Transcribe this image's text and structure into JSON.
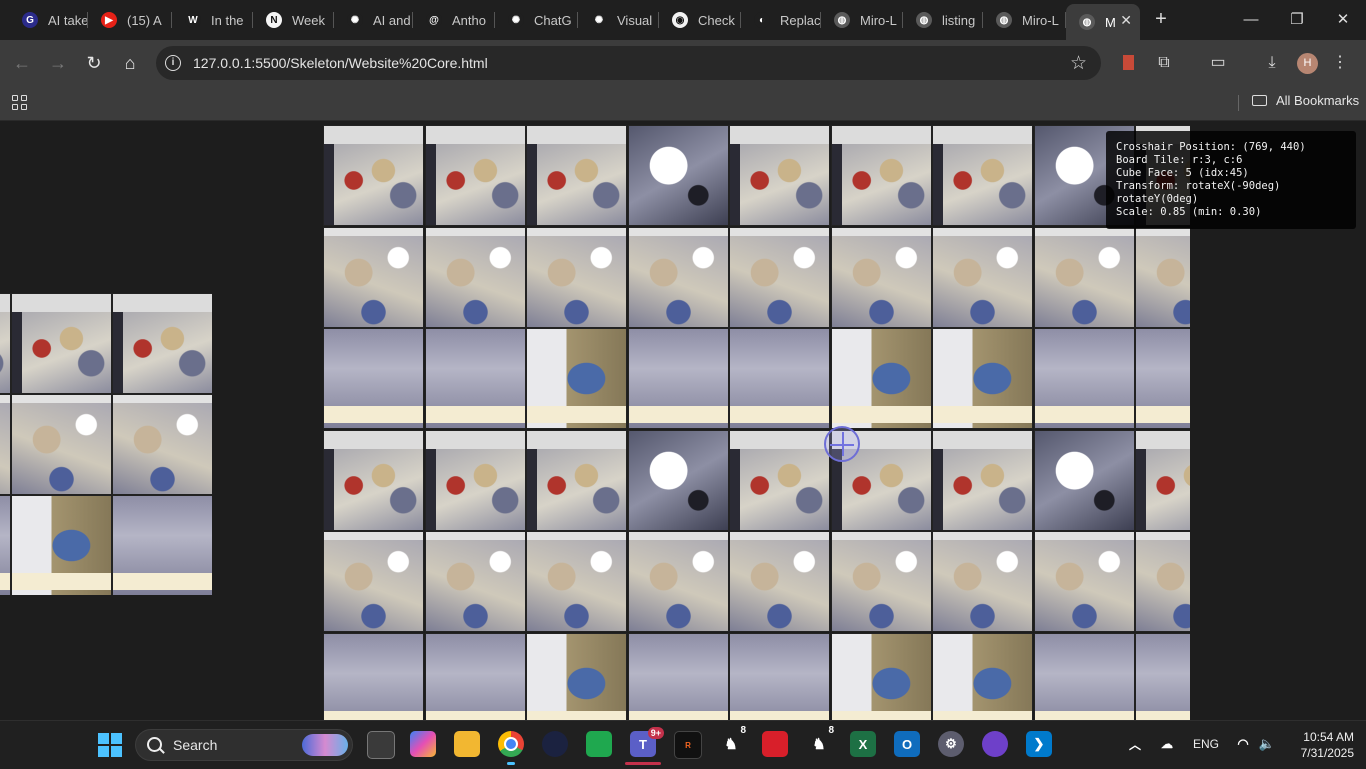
{
  "browser": {
    "tabs": [
      {
        "title": "AI take",
        "favicon": "g-icon",
        "color": "#2b2b8a",
        "glyph": "G"
      },
      {
        "title": "(15) A",
        "favicon": "youtube-icon",
        "color": "#e62117",
        "glyph": "▶"
      },
      {
        "title": "In the",
        "favicon": "wsj-icon",
        "color": "#1f1f1f",
        "glyph": "W"
      },
      {
        "title": "Week",
        "favicon": "notion-icon",
        "color": "#f5f5f5",
        "glyph": "N"
      },
      {
        "title": "AI and",
        "favicon": "openai-icon",
        "color": "#1f1f1f",
        "glyph": "✺"
      },
      {
        "title": "Antho",
        "favicon": "threads-icon",
        "color": "#1f1f1f",
        "glyph": "@"
      },
      {
        "title": "ChatG",
        "favicon": "openai-icon",
        "color": "#1f1f1f",
        "glyph": "✺"
      },
      {
        "title": "Visual",
        "favicon": "openai-icon",
        "color": "#1f1f1f",
        "glyph": "✺"
      },
      {
        "title": "Check",
        "favicon": "check-icon",
        "color": "#f2f2f2",
        "glyph": "◉"
      },
      {
        "title": "Replac",
        "favicon": "github-icon",
        "color": "#1f1f1f",
        "glyph": "◐"
      },
      {
        "title": "Miro-L",
        "favicon": "globe-icon",
        "color": "#5a5a5a",
        "glyph": "◍"
      },
      {
        "title": "listing",
        "favicon": "globe-icon",
        "color": "#5a5a5a",
        "glyph": "◍"
      },
      {
        "title": "Miro-L",
        "favicon": "globe-icon",
        "color": "#5a5a5a",
        "glyph": "◍"
      },
      {
        "title": "M",
        "favicon": "globe-icon",
        "color": "#5a5a5a",
        "glyph": "◍",
        "active": true
      }
    ],
    "url": "127.0.0.1:5500/Skeleton/Website%20Core.html",
    "bookmarks_label": "All Bookmarks",
    "profile_initial": "H"
  },
  "overlay": {
    "lines": [
      "Crosshair Position: (769, 440)",
      "Board Tile: r:3, c:6",
      "Cube Face: 5 (idx:45)",
      "Transform: rotateX(-90deg)",
      "rotateY(0deg)",
      "Scale: 0.85 (min: 0.30)"
    ]
  },
  "taskbar": {
    "search_label": "Search",
    "teams_badge": "9+",
    "app_badge_1": "8",
    "app_badge_2": "8",
    "language": "ENG",
    "time": "10:54 AM",
    "date": "7/31/2025"
  },
  "colors": {
    "accent_blue": "#4cc2ff",
    "crosshair": "#6e6ed6",
    "tile_cream": "#f4ecd2"
  }
}
